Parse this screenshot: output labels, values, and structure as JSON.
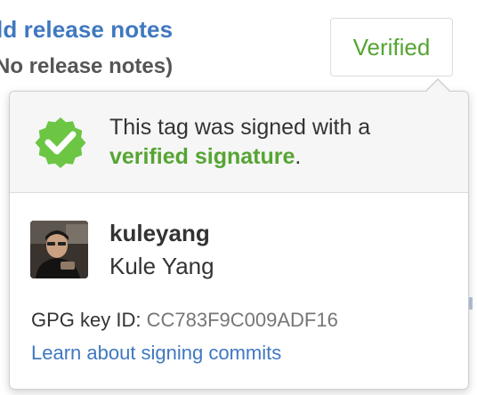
{
  "background": {
    "link_text": "ld release notes",
    "sub_text": "No release notes)"
  },
  "verified_button": {
    "label": "Verified",
    "color": "#55a532"
  },
  "popover": {
    "signature_text_prefix": "This tag was signed with a",
    "signature_strong": "verified signature",
    "signature_suffix": ".",
    "badge_icon": "verified-badge-check-icon",
    "user": {
      "avatar": "user-avatar-photo",
      "username": "kuleyang",
      "full_name": "Kule Yang"
    },
    "gpg_label": "GPG key ID:",
    "gpg_key_id": "CC783F9C009ADF16",
    "learn_link": "Learn about signing commits"
  },
  "colors": {
    "link": "#4078c0",
    "verified_green": "#55a532",
    "header_bg": "#f6f6f6"
  }
}
